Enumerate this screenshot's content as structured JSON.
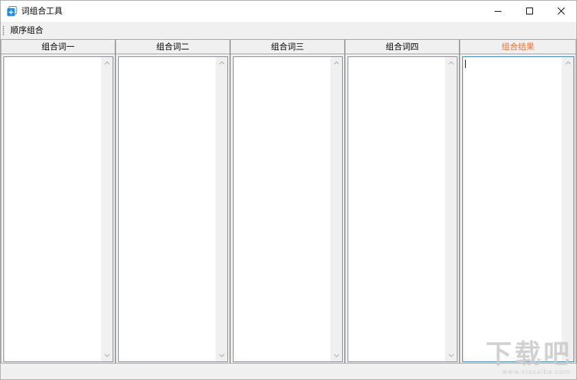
{
  "window": {
    "title": "词组合工具",
    "controls": {
      "minimize_icon": "minimize-icon",
      "maximize_icon": "maximize-icon",
      "close_icon": "close-icon"
    }
  },
  "toolbar": {
    "items": [
      {
        "label": "顺序组合"
      }
    ]
  },
  "columns": [
    {
      "header": "组合词一",
      "value": ""
    },
    {
      "header": "组合词二",
      "value": ""
    },
    {
      "header": "组合词三",
      "value": ""
    },
    {
      "header": "组合词四",
      "value": ""
    },
    {
      "header": "组合结果",
      "value": ""
    }
  ],
  "watermark": {
    "text": "下载吧",
    "subtext": "www.xiazaiba.com"
  },
  "colors": {
    "result_header": "#e8743b",
    "focus_border": "#3c7fb1",
    "app_icon": "#1e88e5"
  }
}
